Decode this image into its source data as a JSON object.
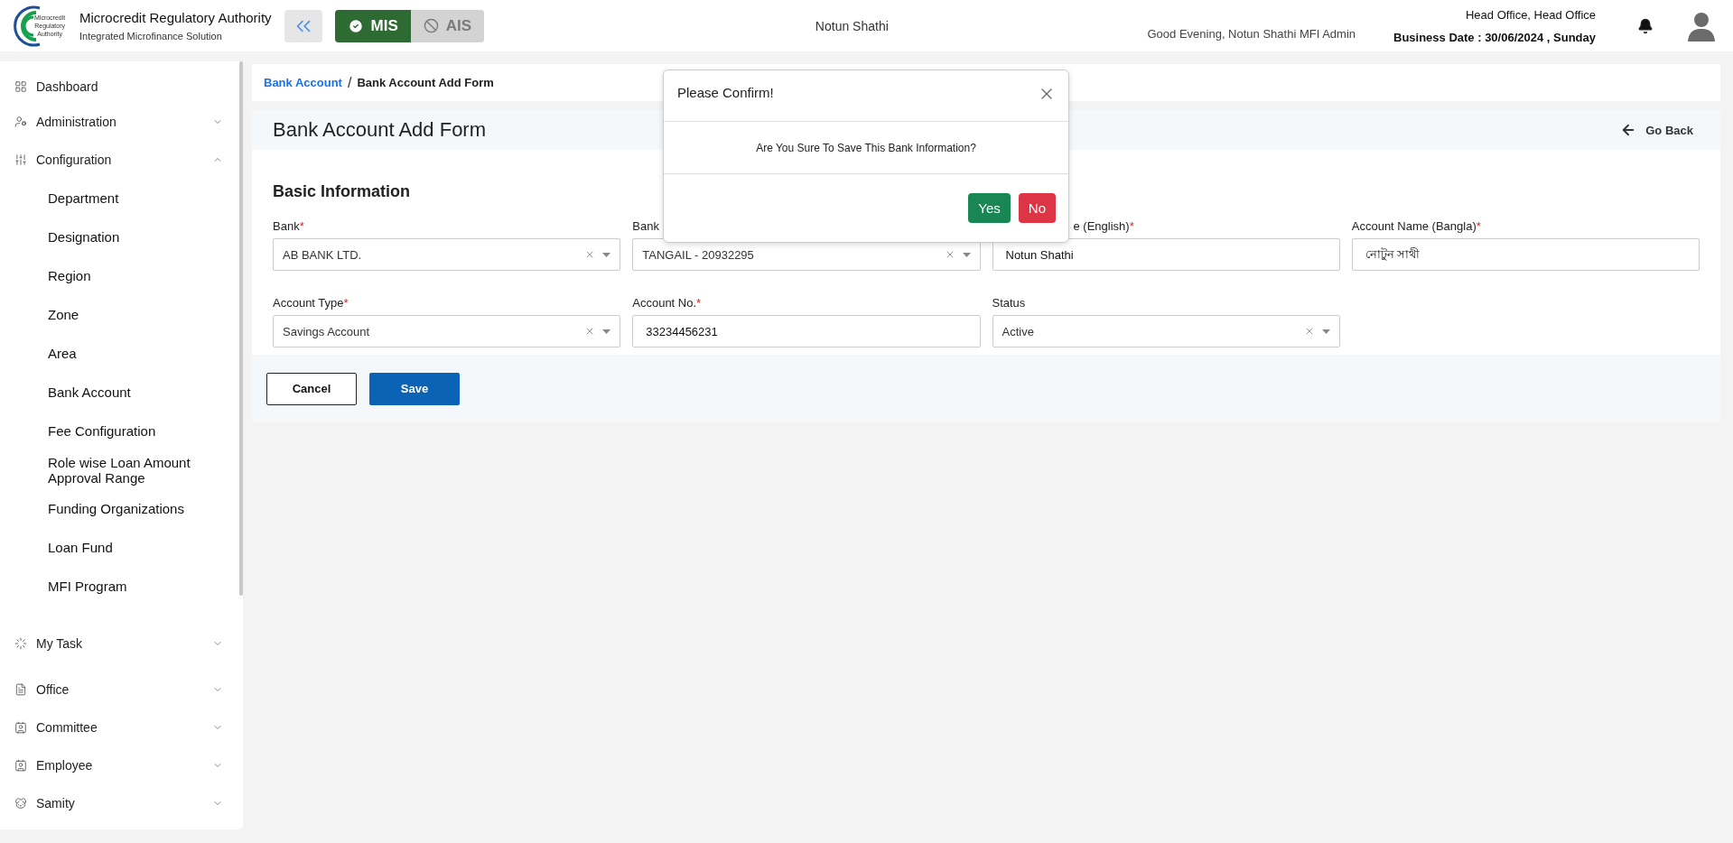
{
  "header": {
    "logo": {
      "mark_lines": [
        "Microcredit",
        "Regulatory",
        "Authority"
      ],
      "title": "Microcredit Regulatory Authority",
      "subtitle": "Integrated Microfinance Solution"
    },
    "modules": [
      {
        "label": "MIS",
        "selected": true
      },
      {
        "label": "AIS",
        "selected": false
      }
    ],
    "organization": "Notun Shathi",
    "greeting": "Good Evening, Notun Shathi MFI Admin",
    "office": "Head Office, Head Office",
    "business_date": "Business Date : 30/06/2024 , Sunday"
  },
  "sidebar": {
    "items": [
      {
        "label": "Dashboard",
        "kind": "link"
      },
      {
        "label": "Administration",
        "kind": "group",
        "expanded": false
      },
      {
        "label": "Configuration",
        "kind": "group",
        "expanded": true,
        "children": [
          {
            "label": "Department"
          },
          {
            "label": "Designation"
          },
          {
            "label": "Region"
          },
          {
            "label": "Zone"
          },
          {
            "label": "Area"
          },
          {
            "label": "Bank Account"
          },
          {
            "label": "Fee Configuration"
          },
          {
            "label": "Role wise Loan Amount Approval Range"
          },
          {
            "label": "Funding Organizations"
          },
          {
            "label": "Loan Fund"
          },
          {
            "label": "MFI Program"
          }
        ]
      },
      {
        "label": "My Task",
        "kind": "group",
        "expanded": false
      },
      {
        "label": "Office",
        "kind": "group",
        "expanded": false
      },
      {
        "label": "Committee",
        "kind": "group",
        "expanded": false
      },
      {
        "label": "Employee",
        "kind": "group",
        "expanded": false
      },
      {
        "label": "Samity",
        "kind": "group",
        "expanded": false
      }
    ]
  },
  "breadcrumb": {
    "separator": "/",
    "items": [
      {
        "label": "Bank Account",
        "kind": "link"
      },
      {
        "label": "Bank Account Add Form",
        "kind": "current"
      }
    ]
  },
  "form": {
    "title": "Bank Account Add Form",
    "go_back": "Go Back",
    "section": "Basic Information",
    "fields": [
      {
        "label": "Bank",
        "asterisk": "*",
        "kind": "select",
        "value": "AB BANK LTD."
      },
      {
        "label": "Bank",
        "kind": "select",
        "value": "TANGAIL - 20932295"
      },
      {
        "label": "e (English)",
        "asterisk": "*",
        "covered": true,
        "kind": "input",
        "value": "Notun Shathi"
      },
      {
        "label": "Account Name (Bangla)",
        "asterisk": "*",
        "kind": "input",
        "value": "নোটুন সাথী"
      },
      {
        "label": "Account Type",
        "asterisk": "*",
        "kind": "select",
        "value": "Savings Account"
      },
      {
        "label": "Account No.",
        "asterisk": "*",
        "kind": "input",
        "value": "33234456231"
      },
      {
        "label": "Status",
        "kind": "select",
        "value": "Active"
      }
    ],
    "buttons": [
      {
        "label": "Cancel",
        "kind": "secondary"
      },
      {
        "label": "Save",
        "kind": "primary"
      }
    ]
  },
  "dialog": {
    "title": "Please Confirm!",
    "message": "Are You Sure To Save This Bank Information?",
    "buttons": [
      {
        "label": "Yes",
        "kind": "confirm"
      },
      {
        "label": "No",
        "kind": "cancel"
      }
    ]
  }
}
